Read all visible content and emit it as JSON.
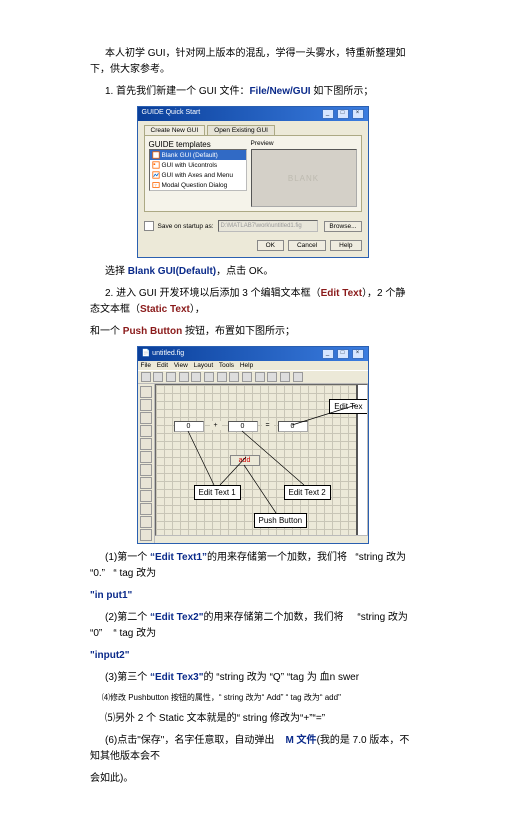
{
  "p1": "本人初学 GUI，针对网上版本的混乱，学得一头雾水，特重新整理如下，供大家参考。",
  "p2_pre": "1. 首先我们新建一个 GUI 文件：",
  "p2_cmd": "File/New/GUI ",
  "p2_post": "如下图所示；",
  "fig1": {
    "title": "GUIDE Quick Start",
    "tab1": "Create New GUI",
    "tab2": "Open Existing GUI",
    "templates_label": "GUIDE templates",
    "items": [
      "Blank GUI (Default)",
      "GUI with Uicontrols",
      "GUI with Axes and Menu",
      "Modal Question Dialog"
    ],
    "preview_label": "Preview",
    "preview_text": "BLANK",
    "save_label": "Save on startup as:",
    "path": "D:\\MATLAB7\\work\\untitled1.fig",
    "browse": "Browse...",
    "ok": "OK",
    "cancel": "Cancel",
    "help": "Help"
  },
  "p3_a": "选择 ",
  "p3_b": "Blank GUI(Default)",
  "p3_c": "，点击 OK。",
  "p4_a": "2. 进入 GUI 开发环境以后添加 3 个编辑文本框（",
  "p4_b": "Edit Text",
  "p4_c": "），2 个静态文本框（",
  "p4_d": "Static Text",
  "p4_e": "），",
  "p5_a": "和一个 ",
  "p5_b": "Push Button",
  "p5_c": " 按钮，布置如下图所示；",
  "fig2": {
    "title": "untitled.fig",
    "menus": [
      "File",
      "Edit",
      "View",
      "Layout",
      "Tools",
      "Help"
    ],
    "ed1": "0",
    "plus": "+",
    "ed2": "0",
    "eq": "=",
    "ed3": "0",
    "addbtn": "add",
    "c_et1": "Edit Text 1",
    "c_et3": "Edit Tex",
    "c_et2": "Edit Text 2",
    "c_pb": "Push Button"
  },
  "p6_a": "(1)第一个 ",
  "p6_b": "“Edit Text1”",
  "p6_c": "的用来存储第一个加数，我们将 ",
  "p6_d": "“string 改为 “0.”",
  "p6_e": " “ tag 改为 ",
  "p7": "\"in put1\"",
  "p8_a": "(2)第二个 ",
  "p8_b": "“Edit Tex2\"",
  "p8_c": "的用来存储第二个加数，我们将 ",
  "p8_d": "“string 改为 “0”",
  "p8_e": "  “ tag 改为 ",
  "p9": "\"input2\"",
  "p10_a": "(3)第三个 ",
  "p10_b": "“Edit Tex3\"",
  "p10_c": "的 ",
  "p10_d": "“string 改为 ",
  "p10_e": "“Q”",
  "p10_f": "  “tag 为 血n swer",
  "p11_a": "⑷修改 Pushbutton 按钮的属性，",
  "p11_b": "“ string 改为",
  "p11_c": "“ Add”",
  "p11_d": "  “ tag 改为",
  "p11_e": "“ add\"",
  "p12_a": "⑸另外 2 个 Static 文本就是的",
  "p12_b": "“ string 修改为",
  "p12_c": "“+”",
  "p12_d": "“=”",
  "p13_a": "(6)点击\"保存\"，名字任意取，自动弹出",
  "p13_b": "M 文件",
  "p13_c": "(我的是 7.0 版本，不知其他版本会不",
  "p14": "会如此)。"
}
